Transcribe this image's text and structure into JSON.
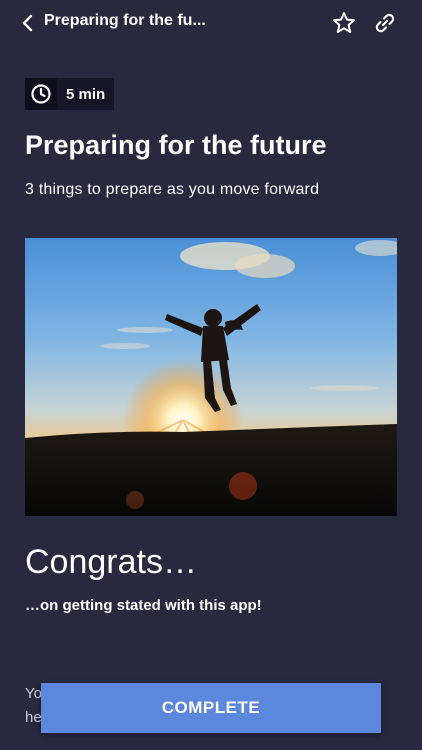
{
  "header": {
    "title": "Preparing for the fu..."
  },
  "badge": {
    "duration": "5 min"
  },
  "article": {
    "title": "Preparing for the future",
    "subtitle": "3 things to prepare as you move forward",
    "section_heading": "Congrats…",
    "section_subheading": "…on getting stated with this app!",
    "body_partial_line1": "Yo",
    "body_partial_line2": "he"
  },
  "footer": {
    "complete_label": "COMPLETE"
  },
  "colors": {
    "background": "#28283f",
    "button": "#5b87dc",
    "text": "#ffffff"
  }
}
